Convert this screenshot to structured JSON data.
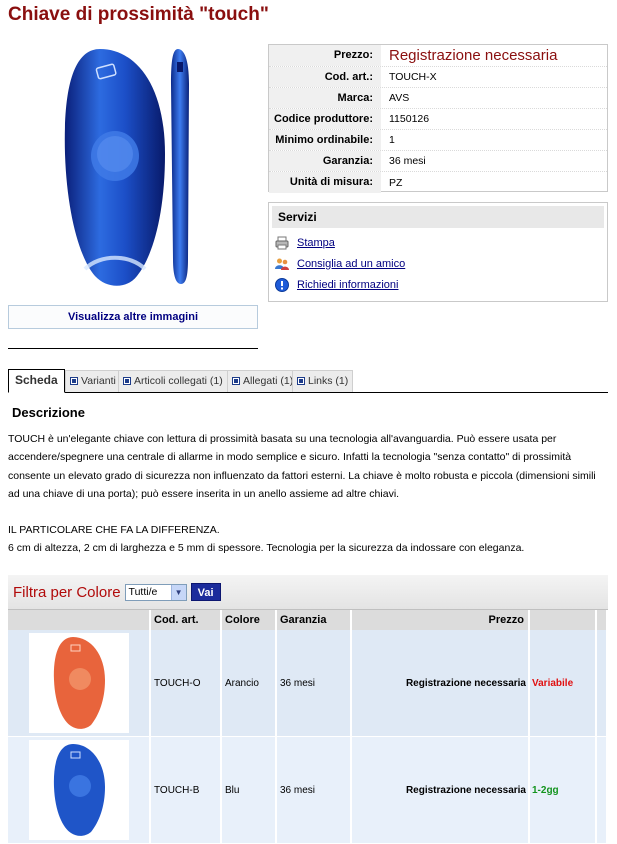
{
  "title": "Chiave di prossimità \"touch\"",
  "view_more_images": "Visualizza altre immagini",
  "info": [
    {
      "label": "Prezzo:",
      "value": "Registrazione necessaria"
    },
    {
      "label": "Cod. art.:",
      "value": "TOUCH-X"
    },
    {
      "label": "Marca:",
      "value": "AVS"
    },
    {
      "label": "Codice produttore:",
      "value": "1150126"
    },
    {
      "label": "Minimo ordinabile:",
      "value": "1"
    },
    {
      "label": "Garanzia:",
      "value": "36 mesi"
    },
    {
      "label": "Unità di misura:",
      "value": "PZ"
    }
  ],
  "services": {
    "title": "Servizi",
    "items": [
      {
        "label": "Stampa",
        "icon": "printer-icon"
      },
      {
        "label": "Consiglia ad un amico",
        "icon": "users-icon"
      },
      {
        "label": "Richiedi informazioni",
        "icon": "info-icon"
      }
    ]
  },
  "tabs": [
    {
      "label": "Scheda"
    },
    {
      "label": "Varianti"
    },
    {
      "label": "Articoli collegati (1)"
    },
    {
      "label": "Allegati (1)"
    },
    {
      "label": "Links (1)"
    }
  ],
  "description": {
    "heading": "Descrizione",
    "para1": "TOUCH è un'elegante chiave con lettura di prossimità basata su una tecnologia all'avanguardia. Può essere usata per accendere/spegnere una centrale di allarme in modo semplice e sicuro. Infatti la tecnologia \"senza contatto\" di prossimità consente un elevato grado di sicurezza non influenzato da fattori esterni. La chiave è molto robusta e piccola (dimensioni simili ad una chiave di una porta); può essere inserita in un anello assieme ad altre chiavi.",
    "para2": "IL PARTICOLARE CHE FA LA DIFFERENZA.",
    "para3": "6 cm di altezza, 2 cm di larghezza e 5 mm di spessore. Tecnologia per la sicurezza da indossare con eleganza."
  },
  "filter": {
    "label": "Filtra per Colore",
    "selected": "Tutti/e",
    "button": "Vai"
  },
  "variants": {
    "headers": {
      "code": "Cod. art.",
      "color": "Colore",
      "warranty": "Garanzia",
      "price": "Prezzo"
    },
    "rows": [
      {
        "code": "TOUCH-O",
        "color": "Arancio",
        "warranty": "36 mesi",
        "price": "Registrazione necessaria",
        "availability": "Variabile",
        "swatch": "#e8643c"
      },
      {
        "code": "TOUCH-B",
        "color": "Blu",
        "warranty": "36 mesi",
        "price": "Registrazione necessaria",
        "availability": "1-2gg",
        "swatch": "#1f55c8"
      }
    ]
  }
}
